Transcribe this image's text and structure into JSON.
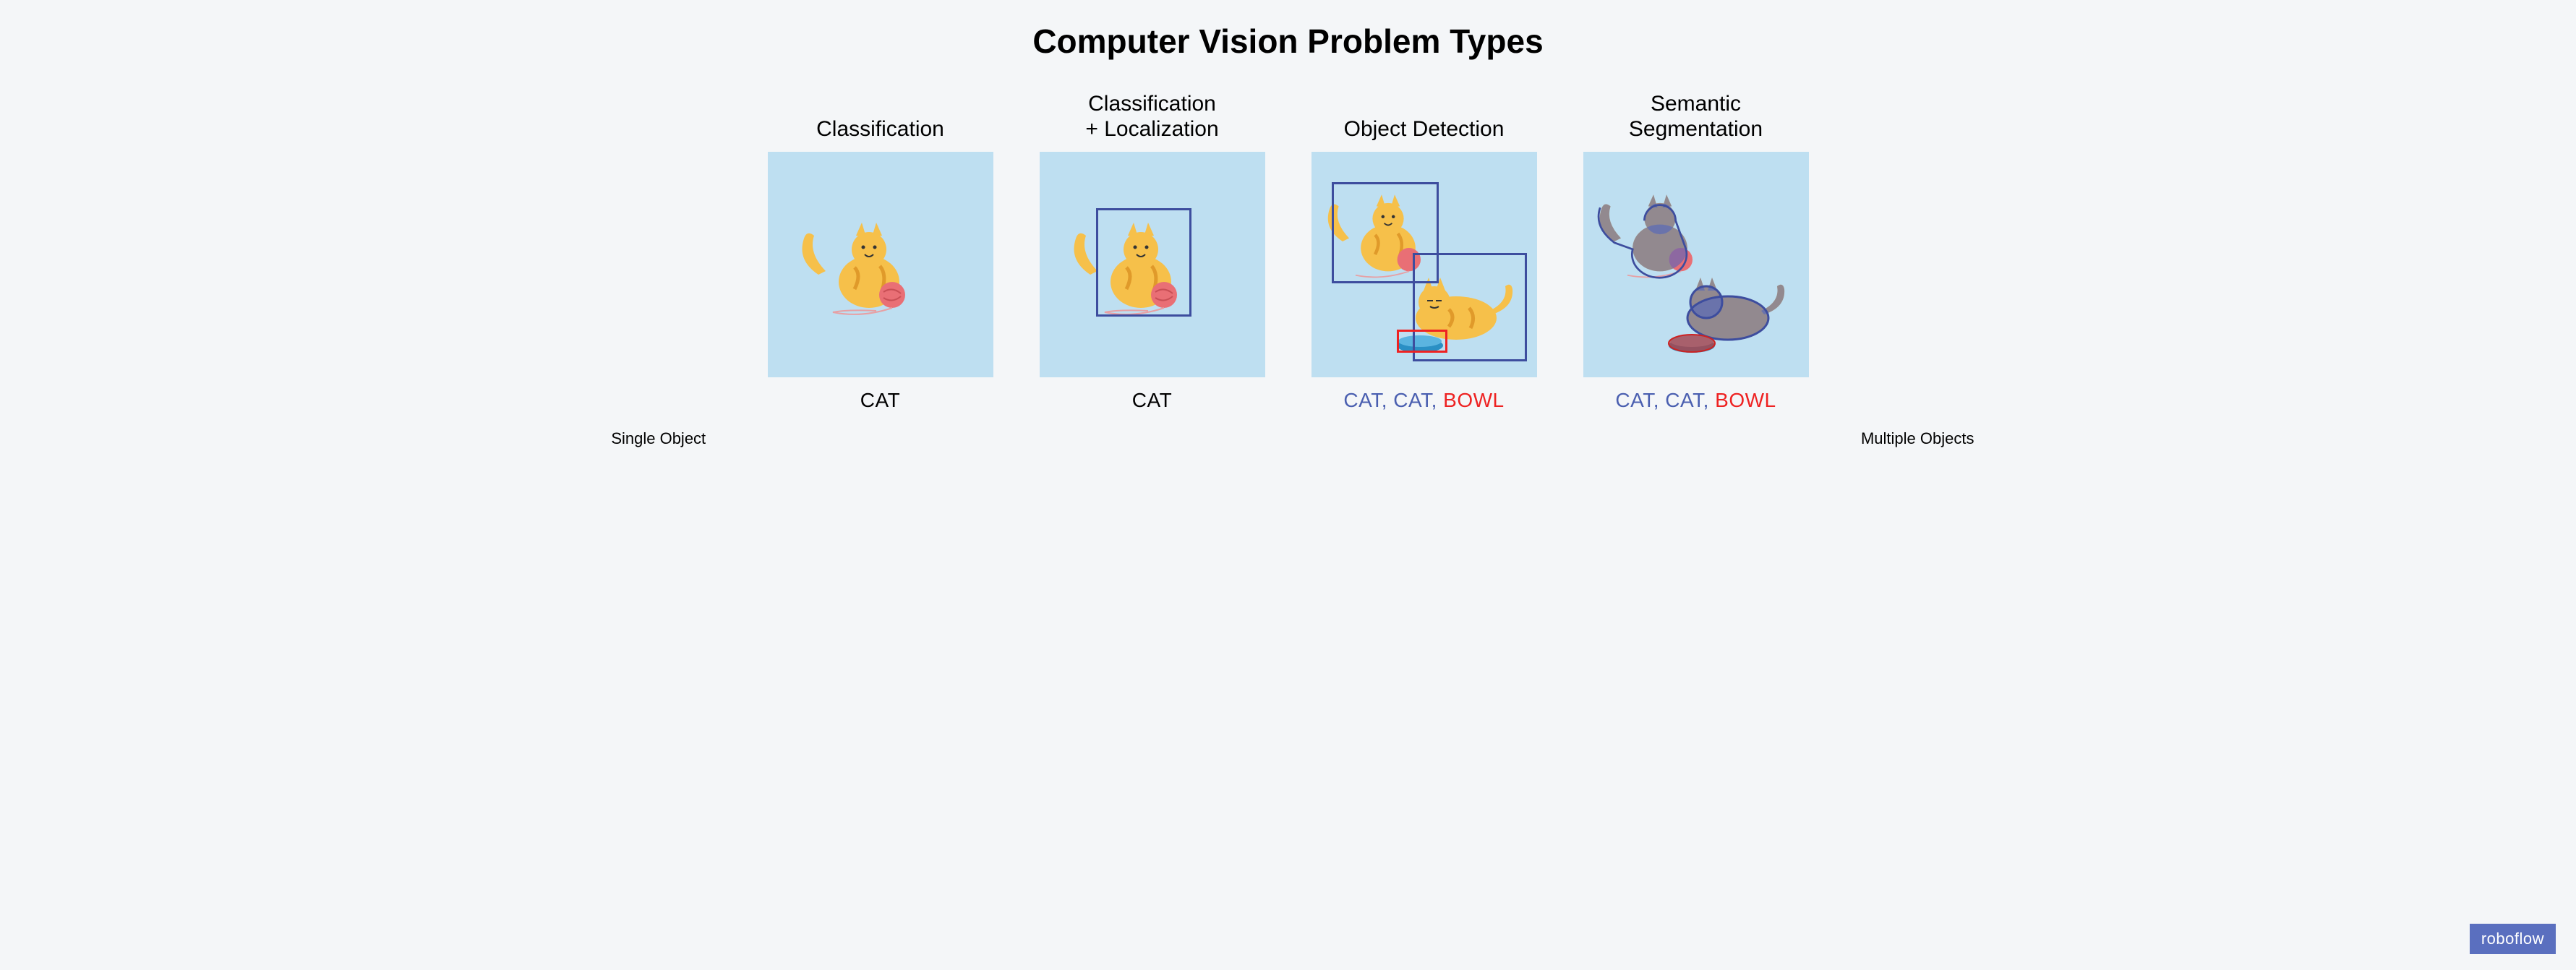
{
  "title": "Computer Vision Problem Types",
  "panels": [
    {
      "title": "Classification",
      "labels": [
        {
          "text": "CAT",
          "cls": "lbl-black"
        }
      ]
    },
    {
      "title": "Classification\n+ Localization",
      "labels": [
        {
          "text": "CAT",
          "cls": "lbl-black"
        }
      ]
    },
    {
      "title": "Object Detection",
      "labels": [
        {
          "text": "CAT",
          "cls": "lbl-blue"
        },
        {
          "text": ", ",
          "cls": "lbl-blue"
        },
        {
          "text": "CAT",
          "cls": "lbl-blue"
        },
        {
          "text": ", ",
          "cls": "lbl-blue"
        },
        {
          "text": "BOWL",
          "cls": "lbl-red"
        }
      ]
    },
    {
      "title": "Semantic\nSegmentation",
      "labels": [
        {
          "text": "CAT",
          "cls": "lbl-blue"
        },
        {
          "text": ", ",
          "cls": "lbl-blue"
        },
        {
          "text": "CAT",
          "cls": "lbl-blue"
        },
        {
          "text": ", ",
          "cls": "lbl-blue"
        },
        {
          "text": "BOWL",
          "cls": "lbl-red"
        }
      ]
    }
  ],
  "groups": {
    "left": "Single Object",
    "right": "Multiple Objects"
  },
  "brand": "roboflow"
}
